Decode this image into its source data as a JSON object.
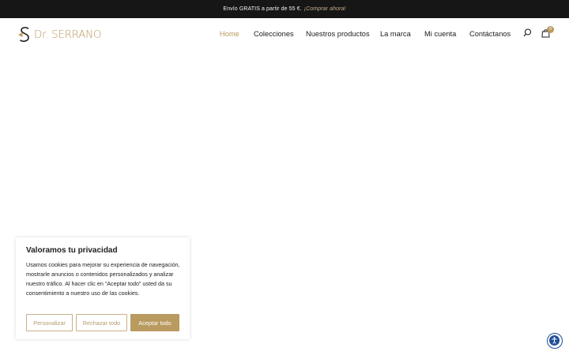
{
  "topbar": {
    "text": "Envío GRATIS a partir de 55 €.",
    "link": "¡Comprar ahora!"
  },
  "brand": {
    "logo_text": "Dr. SERRANO",
    "logo_icon": "sr-monogram-icon",
    "accent": "#b99a5f"
  },
  "nav": {
    "items": [
      {
        "label": "Home",
        "active": true
      },
      {
        "label": "Colecciones"
      },
      {
        "label": "Nuestros productos"
      },
      {
        "label": "La marca"
      },
      {
        "label": "Mi cuenta"
      },
      {
        "label": "Contáctanos"
      }
    ],
    "search_icon": "search-icon",
    "cart_icon": "shopping-bag-icon",
    "cart_count": "0"
  },
  "cookie": {
    "title": "Valoramos tu privacidad",
    "body": "Usamos cookies para mejorar su experiencia de navegación, mostrarle anuncios o contenidos personalizados y analizar nuestro tráfico. Al hacer clic en “Aceptar todo” usted da su consentimiento a nuestro uso de las cookies.",
    "buttons": {
      "customize": "Personalizar",
      "reject": "Rechazar todo",
      "accept": "Aceptar todo"
    }
  },
  "accessibility": {
    "icon": "accessibility-icon",
    "color": "#1f4f95"
  }
}
